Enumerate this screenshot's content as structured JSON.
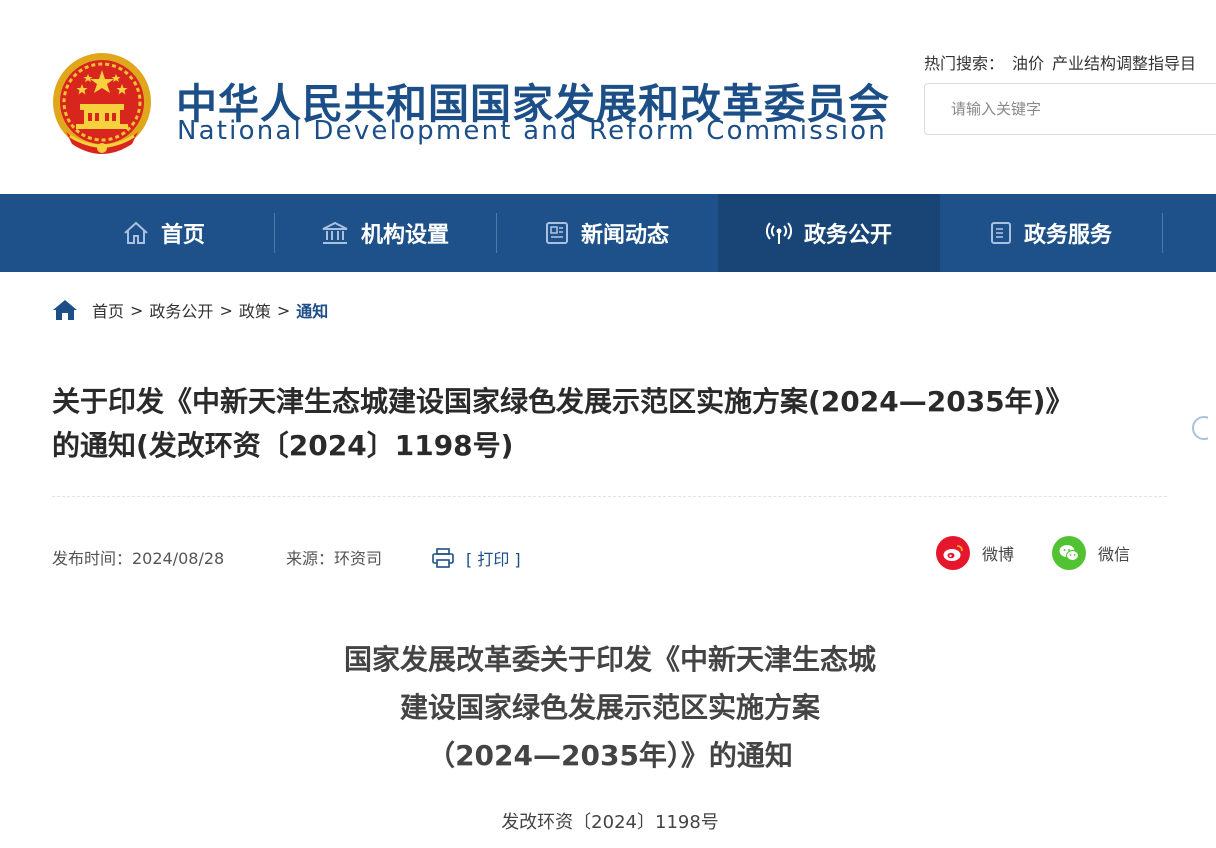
{
  "header": {
    "org_name_cn": "中华人民共和国国家发展和改革委员会",
    "org_name_en": "National Development and Reform Commission",
    "hot_search_label": "热门搜索：",
    "hot_search_items": [
      "油价",
      "产业结构调整指导目"
    ],
    "search_placeholder": "请输入关键字"
  },
  "nav": {
    "items": [
      {
        "label": "首页",
        "icon": "home-icon"
      },
      {
        "label": "机构设置",
        "icon": "institution-icon"
      },
      {
        "label": "新闻动态",
        "icon": "news-icon"
      },
      {
        "label": "政务公开",
        "icon": "broadcast-icon"
      },
      {
        "label": "政务服务",
        "icon": "document-icon"
      }
    ],
    "active": "政务公开"
  },
  "breadcrumb": {
    "items": [
      "首页",
      "政务公开",
      "政策"
    ],
    "current": "通知",
    "separator": ">"
  },
  "article": {
    "title_line1": "关于印发《中新天津生态城建设国家绿色发展示范区实施方案(2024—2035年)》",
    "title_line2": "的通知(发改环资〔2024〕1198号)",
    "publish_time": "发布时间：2024/08/28",
    "source": "来源：环资司",
    "print_label": "[ 打印 ]",
    "share": [
      {
        "label": "微博",
        "icon": "weibo-icon",
        "color": "#e6162d"
      },
      {
        "label": "微信",
        "icon": "wechat-icon",
        "color": "#51c332"
      }
    ],
    "doc_title_line1": "国家发展改革委关于印发《中新天津生态城",
    "doc_title_line2": "建设国家绿色发展示范区实施方案",
    "doc_title_line3": "（2024—2035年）》的通知",
    "doc_number": "发改环资〔2024〕1198号"
  },
  "colors": {
    "brand_blue": "#1c4f87",
    "nav_bg": "#1e5189",
    "nav_active_bg": "#184575"
  }
}
